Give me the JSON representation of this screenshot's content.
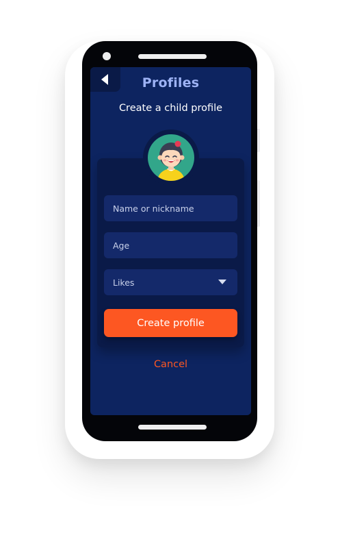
{
  "header": {
    "back_icon": "back-arrow-icon",
    "title": "Profiles"
  },
  "main": {
    "subtitle": "Create a child profile",
    "avatar": {
      "icon": "child-avatar-icon",
      "background_color": "#32a68a"
    },
    "form": {
      "name_placeholder": "Name or nickname",
      "age_placeholder": "Age",
      "likes_placeholder": "Likes",
      "likes_icon": "chevron-down-icon",
      "create_label": "Create profile",
      "cancel_label": "Cancel"
    }
  },
  "colors": {
    "screen_background": "#0d2460",
    "card_background": "#0a1a48",
    "field_background": "#14296a",
    "title_color": "#9db2f4",
    "accent": "#fd5722"
  }
}
